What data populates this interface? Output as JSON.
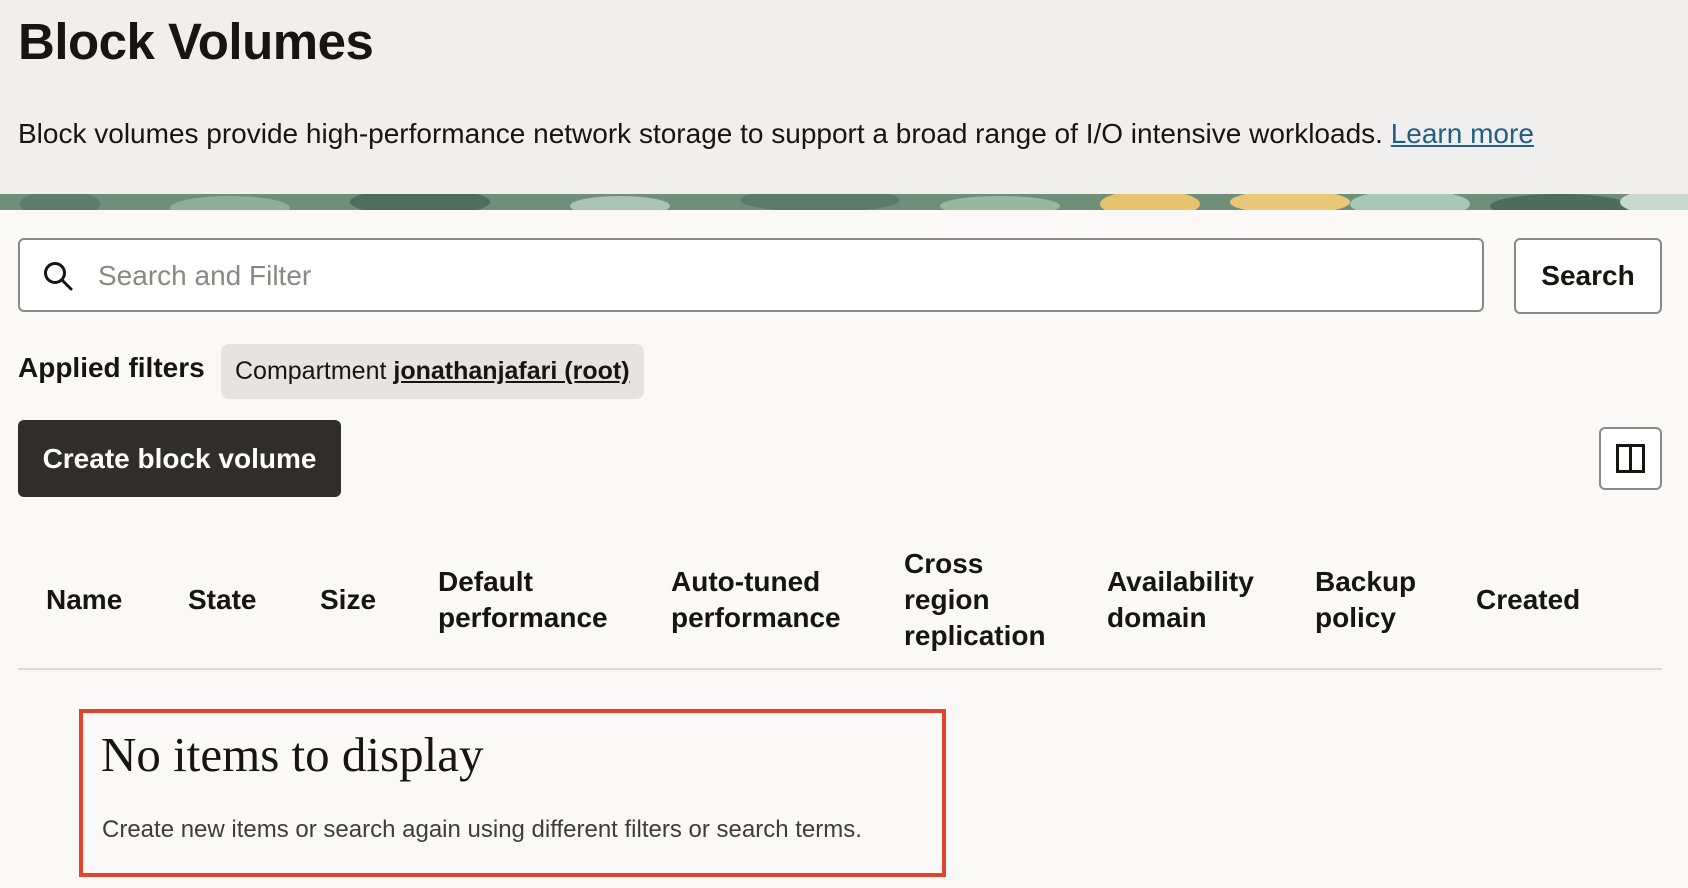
{
  "header": {
    "title": "Block Volumes",
    "description": "Block volumes provide high-performance network storage to support a broad range of I/O intensive workloads.",
    "learn_more": "Learn more"
  },
  "search": {
    "placeholder": "Search and Filter",
    "value": "",
    "button_label": "Search"
  },
  "filters": {
    "label": "Applied filters",
    "chips": [
      {
        "name": "Compartment",
        "value": "jonathanjafari (root)"
      }
    ]
  },
  "actions": {
    "create_label": "Create block volume"
  },
  "table": {
    "columns": [
      [
        "Name"
      ],
      [
        "State"
      ],
      [
        "Size"
      ],
      [
        "Default",
        "performance"
      ],
      [
        "Auto-tuned",
        "performance"
      ],
      [
        "Cross",
        "region",
        "replication"
      ],
      [
        "Availability",
        "domain"
      ],
      [
        "Backup",
        "policy"
      ],
      [
        "Created"
      ]
    ],
    "rows": []
  },
  "empty_state": {
    "title": "No items to display",
    "description": "Create new items or search again using different filters or search terms."
  },
  "colors": {
    "header_bg": "#f1efed",
    "page_bg": "#fbf9f8",
    "primary_button": "#312d2a",
    "link": "#1f5f86",
    "highlight_border": "#e4432e"
  },
  "icons": {
    "search": "search-icon",
    "columns": "columns-icon"
  }
}
